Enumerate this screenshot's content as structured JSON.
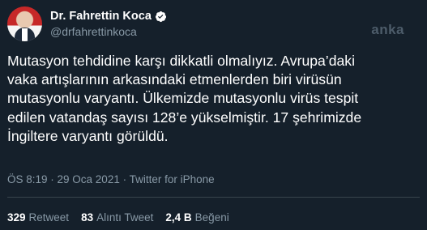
{
  "author": {
    "display_name": "Dr. Fahrettin Koca",
    "handle": "@drfahrettinkoca",
    "verified_icon": "verified-badge-icon"
  },
  "watermark": "anka",
  "tweet": {
    "text": "Mutasyon tehdidine karşı dikkatli olmalıyız. Avrupa’daki\nvaka artışlarının arkasındaki etmenlerden biri virüsün\nmutasyonlu varyantı. Ülkemizde mutasyonlu virüs tespit\nedilen vatandaş sayısı 128’e yükselmiştir. 17 şehrimizde\nİngiltere varyantı görüldü.",
    "meta": "ÖS 8:19 · 29 Oca 2021 · Twitter for iPhone"
  },
  "stats": [
    {
      "count": "329",
      "label": "Retweet"
    },
    {
      "count": "83",
      "label": "Alıntı Tweet"
    },
    {
      "count": "2,4 B",
      "label": "Beğeni"
    }
  ],
  "colors": {
    "background": "#15202b",
    "secondary_text": "#8899a6",
    "verified": "#1da1f2",
    "divider": "#38444d"
  }
}
